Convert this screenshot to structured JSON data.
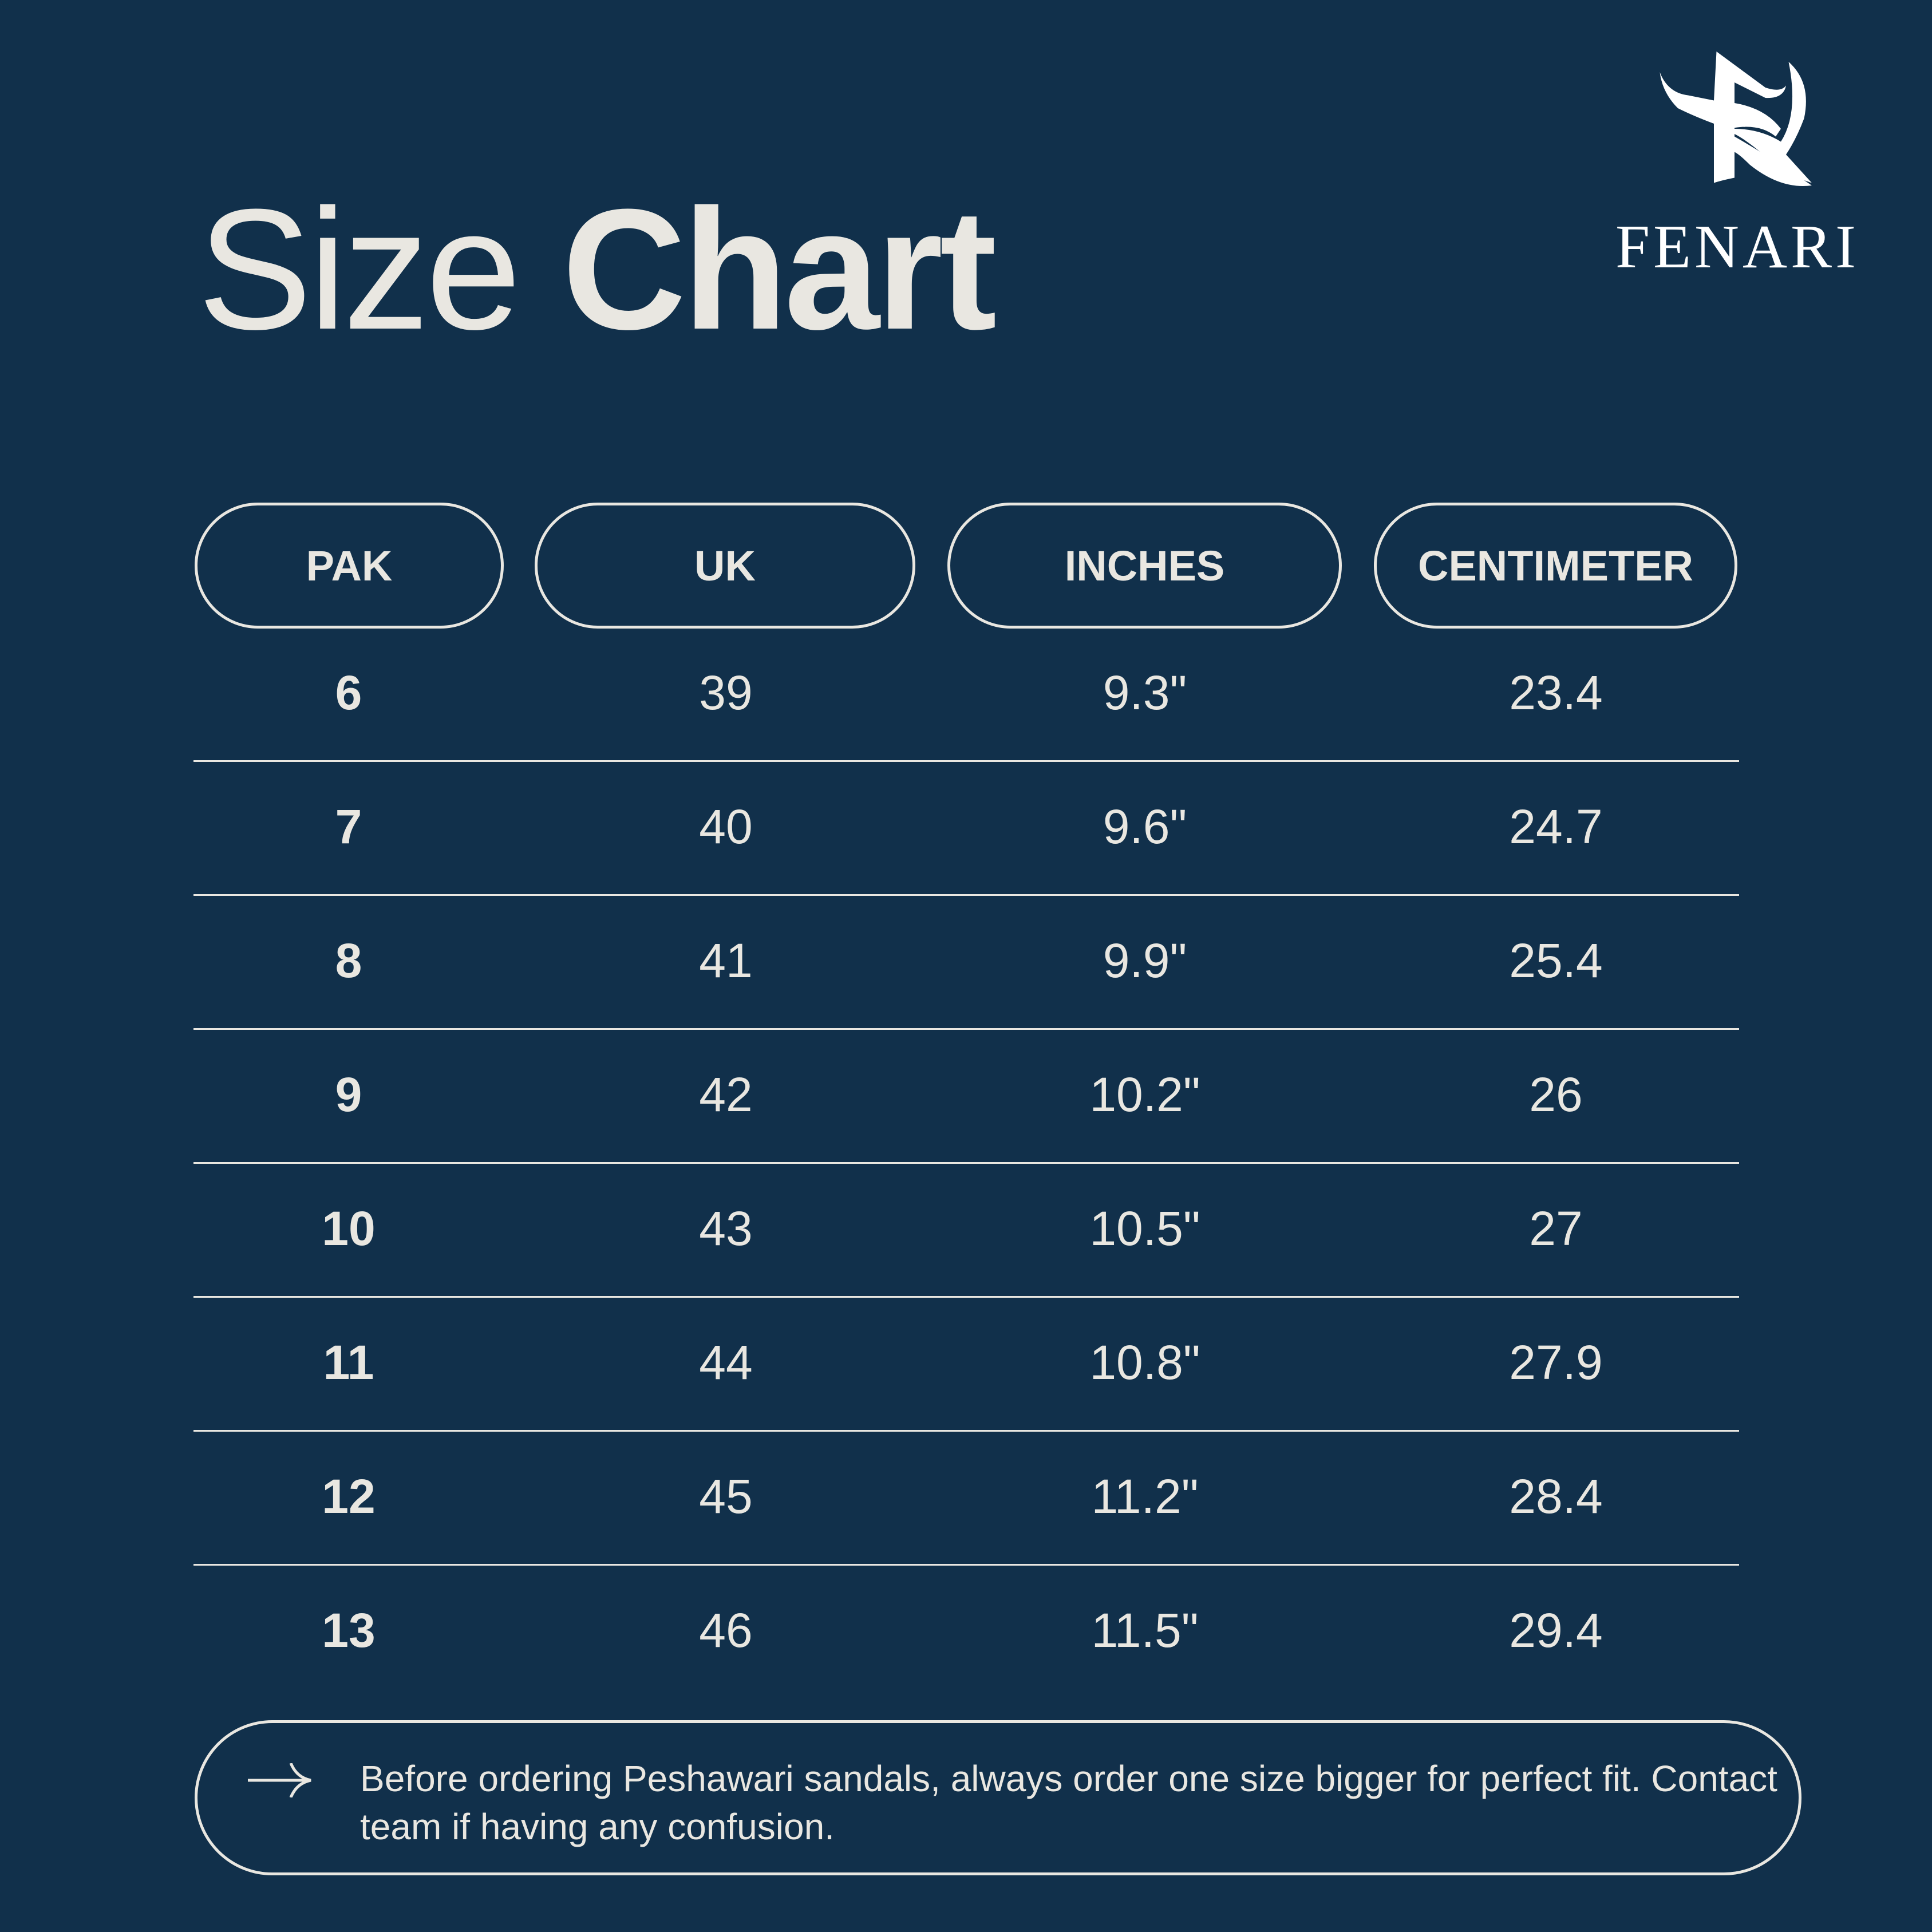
{
  "header": {
    "title_light": "Size",
    "title_bold": "Chart"
  },
  "logo": {
    "brand": "FENARI",
    "icon": "fenari-r-logo-icon"
  },
  "table": {
    "columns": [
      "PAK",
      "UK",
      "INCHES",
      "CENTIMETER"
    ],
    "rows": [
      [
        "6",
        "39",
        "9.3\"",
        "23.4"
      ],
      [
        "7",
        "40",
        "9.6\"",
        "24.7"
      ],
      [
        "8",
        "41",
        "9.9\"",
        "25.4"
      ],
      [
        "9",
        "42",
        "10.2\"",
        "26"
      ],
      [
        "10",
        "43",
        "10.5\"",
        "27"
      ],
      [
        "11",
        "44",
        "10.8\"",
        "27.9"
      ],
      [
        "12",
        "45",
        "11.2\"",
        "28.4"
      ],
      [
        "13",
        "46",
        "11.5\"",
        "29.4"
      ]
    ]
  },
  "note": {
    "icon": "arrow-right-icon",
    "text": "Before ordering Peshawari sandals, always order one size bigger for perfect fit. Contact team if having any confusion."
  },
  "colors": {
    "background": "#11304b",
    "foreground": "#e9e7e1"
  }
}
